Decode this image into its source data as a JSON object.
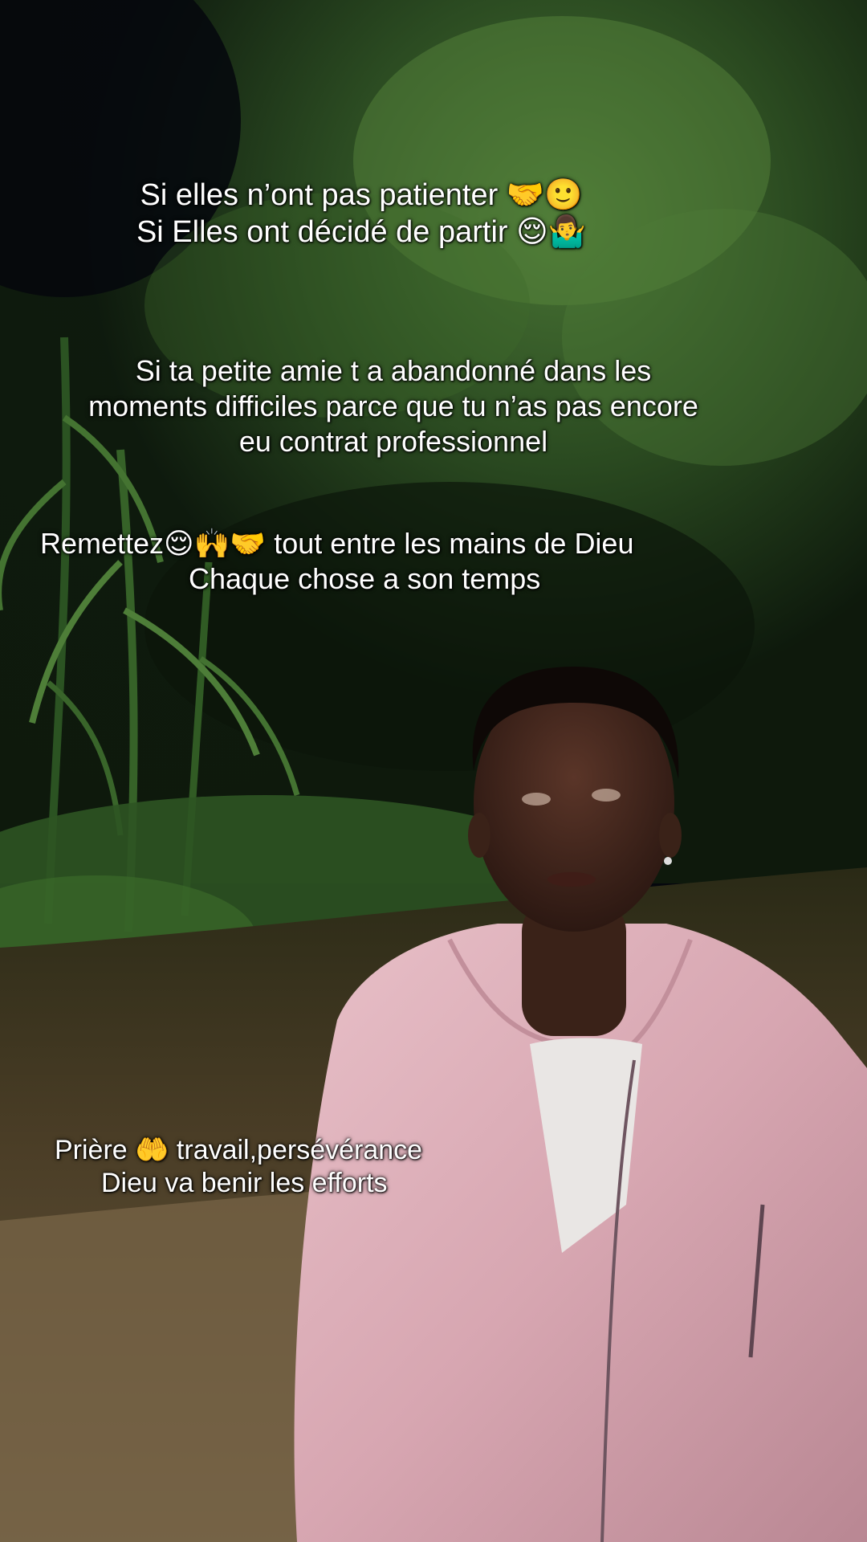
{
  "captions": {
    "block1": {
      "line1": "Si elles n’ont pas patienter 🤝🙂",
      "line2": "Si Elles ont décidé de partir 😌🤷‍♂️"
    },
    "block2": {
      "line1": "Si ta petite amie t a abandonné dans les",
      "line2": "moments difficiles  parce que tu n’as pas encore",
      "line3": "eu contrat professionnel"
    },
    "block3": {
      "line1": "Remettez😌🙌🤝 tout entre les mains de Dieu",
      "line2": "Chaque chose a son temps"
    },
    "block4": {
      "line1": "Prière 🤲 travail,persévérance",
      "line2": "Dieu va benir les efforts"
    }
  },
  "scene": {
    "subject": "young man in pink jacket",
    "setting": "night, trees and maize plants, dirt path"
  },
  "colors": {
    "sky": "#0a0f1f",
    "foliage": "#1f3a1a",
    "jacket": "#d9a9b4",
    "path": "#5a4a30"
  }
}
